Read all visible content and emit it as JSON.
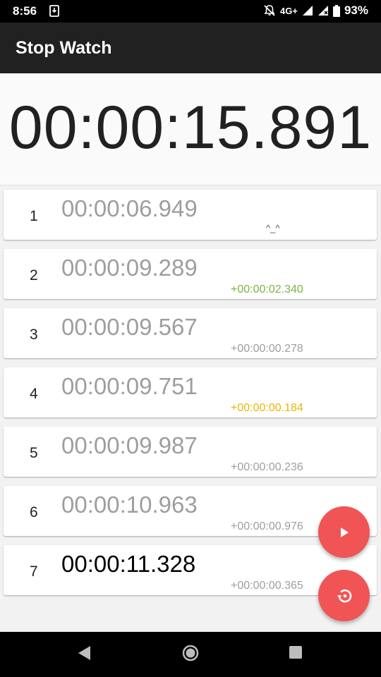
{
  "status_bar": {
    "time": "8:56",
    "network": "4G+",
    "battery": "93%",
    "icons": [
      "download-icon",
      "mute-icon",
      "signal-icon",
      "signal-icon",
      "battery-icon"
    ]
  },
  "app_bar": {
    "title": "Stop Watch"
  },
  "timer": {
    "display": "00:00:15.891"
  },
  "laps": [
    {
      "number": "1",
      "time": "00:00:06.949",
      "extra": "^_^"
    },
    {
      "number": "2",
      "time": "00:00:09.289",
      "delta": "+00:00:02.340"
    },
    {
      "number": "3",
      "time": "00:00:09.567",
      "delta": "+00:00:00.278"
    },
    {
      "number": "4",
      "time": "00:00:09.751",
      "delta": "+00:00:00.184"
    },
    {
      "number": "5",
      "time": "00:00:09.987",
      "delta": "+00:00:00.236"
    },
    {
      "number": "6",
      "time": "00:00:10.963",
      "delta": "+00:00:00.976"
    },
    {
      "number": "7",
      "time": "00:00:11.328",
      "delta": "+00:00:00.365"
    }
  ],
  "colors": {
    "fab": "#f05454",
    "delta_positive": "#7cb342",
    "delta_best": "#e6b800",
    "delta_default": "#9e9e9e"
  },
  "buttons": {
    "play_icon": "play-icon",
    "reset_icon": "reset-icon"
  },
  "nav_bar": {
    "icons": [
      "back-icon",
      "home-icon",
      "recents-icon"
    ]
  }
}
